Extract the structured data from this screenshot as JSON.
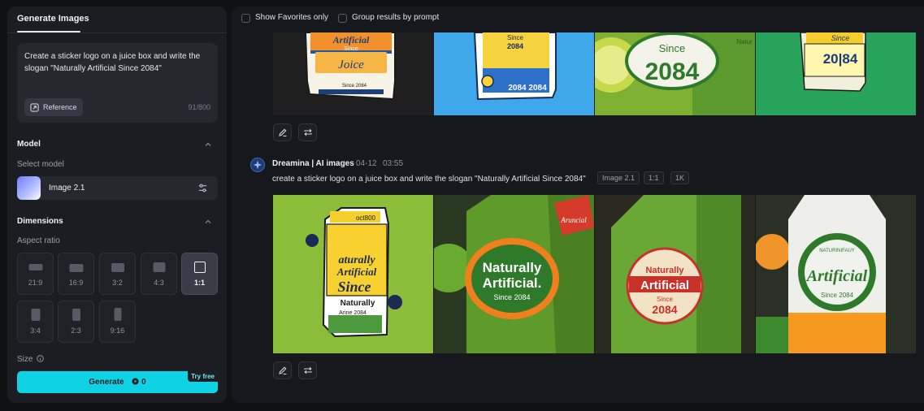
{
  "left_panel": {
    "tab_label": "Generate Images",
    "prompt_text": "Create a sticker logo on a juice box and write the slogan \"Naturally Artificial Since 2084\"",
    "reference_label": "Reference",
    "char_count": "91/800",
    "model": {
      "section_title": "Model",
      "select_label": "Select model",
      "selected_model": "Image 2.1"
    },
    "dimensions": {
      "section_title": "Dimensions",
      "aspect_label": "Aspect ratio",
      "ratios": [
        "21:9",
        "16:9",
        "3:2",
        "4:3",
        "1:1",
        "3:4",
        "2:3",
        "9:16"
      ],
      "selected_ratio": "1:1"
    },
    "size_label": "Size",
    "generate_label": "Generate",
    "generate_cost": "0",
    "try_free_label": "Try free"
  },
  "right_panel": {
    "filters": {
      "show_favorites_label": "Show Favorites only",
      "group_by_prompt_label": "Group results by prompt"
    },
    "generation": {
      "author": "Dreamina | AI images",
      "date": "04-12",
      "time": "03:55",
      "prompt": "create a sticker logo on a juice box and write the slogan \"Naturally Artificial Since 2084\"",
      "tags": [
        "Image 2.1",
        "1:1",
        "1K"
      ]
    },
    "image_texts": {
      "top1_a": "Artificial",
      "top1_b": "Since",
      "top1_c": "Joice",
      "top1_d": "Since 2084",
      "top2_a": "Since",
      "top2_b": "2084",
      "top2_c": "2084 2084",
      "top3_a": "Since",
      "top3_b": "2084",
      "top3_c": "Natur",
      "top4_a": "Since",
      "top4_b": "20|84",
      "b1_a": "aturally",
      "b1_b": "Artificial",
      "b1_c": "Since",
      "b1_d": "Naturally",
      "b1_e": "Arine 2084",
      "b1_f": "oct800",
      "b2_a": "Naturally",
      "b2_b": "Artificial.",
      "b2_c": "Since 2084",
      "b2_d": "Aruncial",
      "b3_a": "Naturally",
      "b3_b": "Artificial",
      "b3_c": "Since",
      "b3_d": "2084",
      "b4_a": "NATURINIFAUY",
      "b4_b": "Artificial",
      "b4_c": "Since 2084"
    }
  },
  "colors": {
    "accent": "#10d2e5",
    "panel": "#1b1d23",
    "background": "#101114"
  }
}
